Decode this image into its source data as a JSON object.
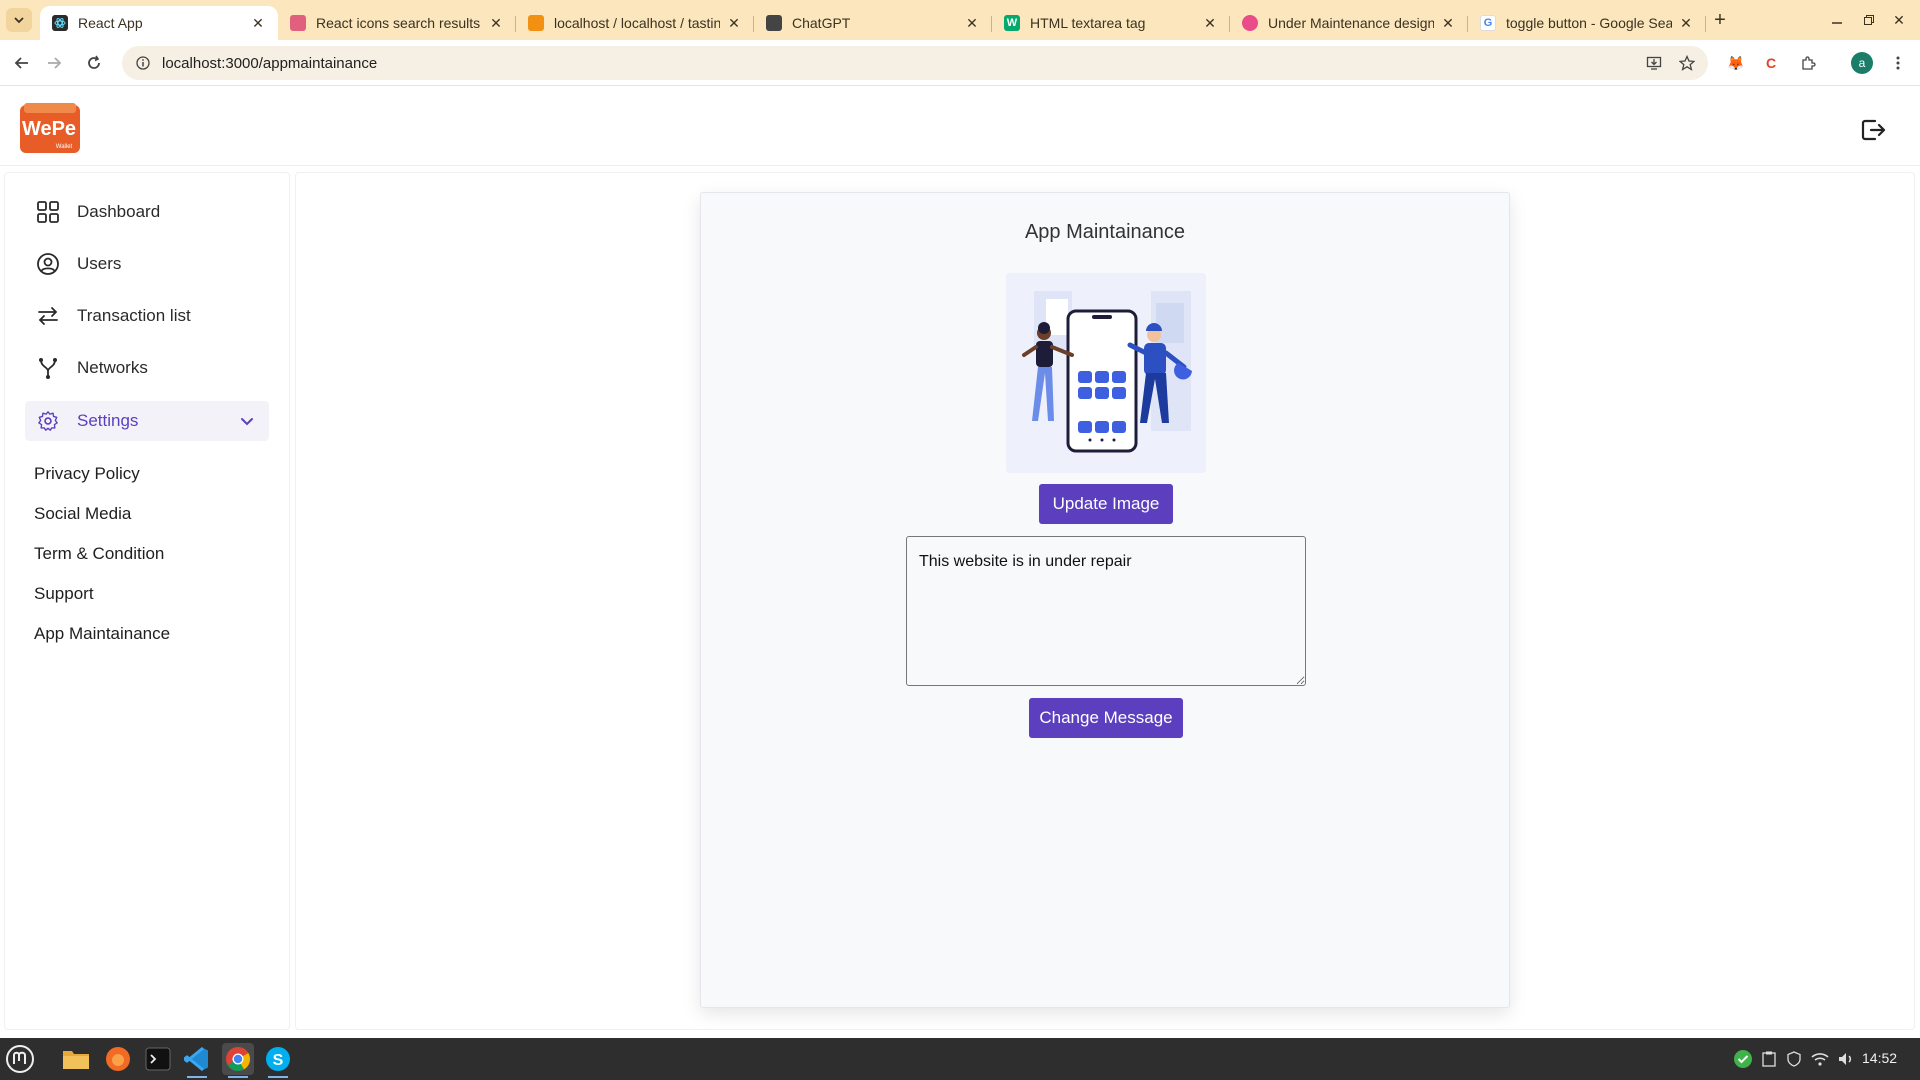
{
  "browser": {
    "tabs": [
      {
        "title": "React App",
        "active": true,
        "favicon_color": "#2b2b2b"
      },
      {
        "title": "React icons search results",
        "active": false,
        "favicon_color": "#e0607e"
      },
      {
        "title": "localhost / localhost / tastin",
        "active": false,
        "favicon_color": "#f29111"
      },
      {
        "title": "ChatGPT",
        "active": false,
        "favicon_color": "#444444"
      },
      {
        "title": "HTML textarea tag",
        "active": false,
        "favicon_color": "#04aa6d"
      },
      {
        "title": "Under Maintenance designs,",
        "active": false,
        "favicon_color": "#ea4c89"
      },
      {
        "title": "toggle button - Google Sear",
        "active": false,
        "favicon_color": "#4285f4"
      }
    ],
    "url": "localhost:3000/appmaintainance",
    "profile_initial": "a"
  },
  "app": {
    "logo_text": "WePe",
    "logo_subtext": "Wallet"
  },
  "sidebar": {
    "items": [
      {
        "label": "Dashboard",
        "icon": "dashboard-grid-icon"
      },
      {
        "label": "Users",
        "icon": "user-circle-icon"
      },
      {
        "label": "Transaction list",
        "icon": "arrows-exchange-icon"
      },
      {
        "label": "Networks",
        "icon": "network-fork-icon"
      },
      {
        "label": "Settings",
        "icon": "gear-icon",
        "expanded": true
      }
    ],
    "settings_sub": [
      {
        "label": "Privacy Policy"
      },
      {
        "label": "Social Media"
      },
      {
        "label": "Term & Condition"
      },
      {
        "label": "Support"
      },
      {
        "label": "App Maintainance"
      }
    ]
  },
  "main": {
    "title": "App Maintainance",
    "update_image_label": "Update Image",
    "message_value": "This website is in under repair",
    "change_message_label": "Change Message"
  },
  "taskbar": {
    "time": "14:52"
  },
  "colors": {
    "accent": "#5b3fbf",
    "tabbar": "#fbe6bd"
  }
}
